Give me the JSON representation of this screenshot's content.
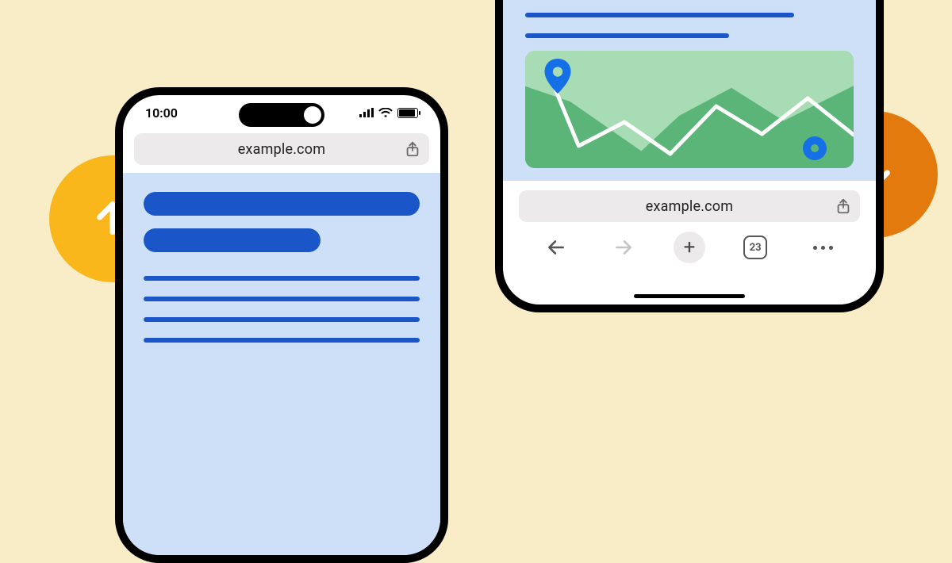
{
  "left_circle": {
    "direction": "up"
  },
  "right_circle": {
    "direction": "down"
  },
  "phone_left": {
    "status": {
      "time": "10:00"
    },
    "address_bar": {
      "url": "example.com"
    }
  },
  "phone_right": {
    "address_bar": {
      "url": "example.com"
    },
    "toolbar": {
      "plus_label": "+",
      "tab_count": "23"
    }
  }
}
